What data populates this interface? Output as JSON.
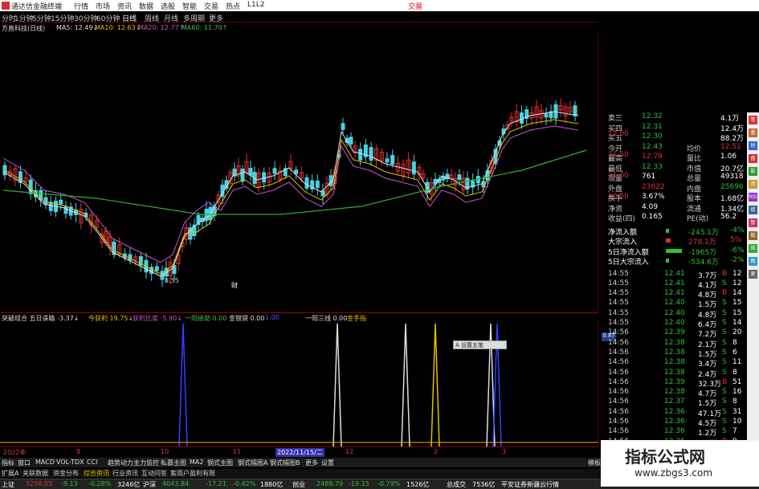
{
  "titlebar": {
    "app": "通达信金融终端",
    "menu": [
      "行情",
      "市场",
      "资讯",
      "数据",
      "选股",
      "智能",
      "交易",
      "热点",
      "L1L2"
    ],
    "right": "交易"
  },
  "periodbar": [
    "分时",
    "1分钟",
    "5分钟",
    "15分钟",
    "30分钟",
    "60分钟",
    "日线",
    "周线",
    "月线",
    "多周期",
    "更多"
  ],
  "malegend": {
    "name": "方直科技(日线)",
    "ma5": "MA5: 12.49↓",
    "ma10": "MA10: 12.63↓",
    "ma20": "MA20: 12.77↑",
    "ma60": "MA60: 11.70↑"
  },
  "kchart": {
    "low_label": "8.55",
    "marker": "财"
  },
  "ilegend": [
    {
      "t": "突破组合 五日诛瞌 -3.37↓",
      "c": "#ddd"
    },
    {
      "t": "今获利 19.75↓",
      "c": "#e0c000"
    },
    {
      "t": "获利比度 -5.90↓",
      "c": "#d050d0"
    },
    {
      "t": "一阳接助 0.00",
      "c": "#40c040"
    },
    {
      "t": "金银袋 0.00",
      "c": "#ddd"
    },
    {
      "t": "1.00",
      "c": "#4060ff"
    },
    {
      "t": "一阳三线 0.00",
      "c": "#ddd"
    },
    {
      "t": "金手指",
      "c": "#e0c000"
    }
  ],
  "datebar": [
    "2022年",
    "8",
    "10",
    "11",
    "2022/11/15/二",
    "12",
    "2",
    "3"
  ],
  "tabs": [
    "指标",
    "窗口",
    "MACD",
    "VOL-TDX",
    "CCI",
    "趋势动力",
    "主力监控",
    "私募主图",
    "MA2",
    "钢式主图",
    "钢式幅图A",
    "钢式幅图B",
    "更多",
    "设置"
  ],
  "stockbar": [
    {
      "t": "扩展A",
      "c": "#ccc"
    },
    {
      "t": "关联数据",
      "c": "#ccc"
    },
    {
      "t": "资金分布",
      "c": "#ccc"
    },
    {
      "t": "综合资讯",
      "c": "#e0c000"
    },
    {
      "t": "行业资讯",
      "c": "#ccc"
    },
    {
      "t": "互动问答",
      "c": "#ccc"
    },
    {
      "t": "紫雨户盈利有限",
      "c": "#ccc"
    }
  ],
  "statusbar": [
    {
      "t": "上证",
      "c": "#fff"
    },
    {
      "t": "3258.03",
      "c": "#e03030"
    },
    {
      "t": "-9.13",
      "c": "#30c030"
    },
    {
      "t": "-0.28%",
      "c": "#30c030"
    },
    {
      "t": "3246亿",
      "c": "#fff"
    },
    {
      "t": "沪深",
      "c": "#fff"
    },
    {
      "t": "4043.84",
      "c": "#30c030"
    },
    {
      "t": "-17.21",
      "c": "#30c030"
    },
    {
      "t": "-0.42%",
      "c": "#30c030"
    },
    {
      "t": "1880亿",
      "c": "#fff"
    },
    {
      "t": "创业",
      "c": "#fff"
    },
    {
      "t": "2489.79",
      "c": "#30c030"
    },
    {
      "t": "-19.15",
      "c": "#30c030"
    },
    {
      "t": "-0.79%",
      "c": "#30c030"
    },
    {
      "t": "1526亿",
      "c": "#fff"
    },
    {
      "t": "总成交",
      "c": "#fff"
    },
    {
      "t": "7536亿",
      "c": "#fff"
    },
    {
      "t": "平安证券新疆云行情",
      "c": "#fff"
    }
  ],
  "quote": [
    {
      "l": "卖三",
      "v": "12.32",
      "v2": "4.1万"
    },
    {
      "l": "买四",
      "v": "12.31",
      "v2": "12.4万"
    },
    {
      "l": "买五",
      "v": "12.30",
      "v2": "88.2万"
    },
    {
      "l": "今开",
      "v": "12.43",
      "l2": "均价",
      "v2": "12.51"
    },
    {
      "l": "最高",
      "v": "12.79",
      "l2": "量比",
      "v2": "1.06"
    },
    {
      "l": "最低",
      "v": "12.33",
      "l2": "市值",
      "v2": "20.7亿"
    },
    {
      "l": "现量",
      "v": "761",
      "l2": "总量",
      "v2": "49318"
    },
    {
      "l": "外盘",
      "v": "23622",
      "l2": "内盘",
      "v2": "25696"
    },
    {
      "l": "换手",
      "v": "3.67%",
      "l2": "股本",
      "v2": "1.68亿"
    },
    {
      "l": "净资",
      "v": "4.09",
      "l2": "流通",
      "v2": "1.34亿"
    },
    {
      "l": "收益(四)",
      "v": "0.165",
      "l2": "PE(动)",
      "v2": "56.2"
    }
  ],
  "flows": [
    {
      "l": "净流入额",
      "v": "-245.1万",
      "p": "-4%"
    },
    {
      "l": "大宗流入",
      "v": "278.1万",
      "p": "5%"
    },
    {
      "l": "5日净流入额",
      "v": "-1965万",
      "p": "-6%"
    },
    {
      "l": "5日大宗流入",
      "v": "-534.6万",
      "p": "-2%"
    }
  ],
  "trades": [
    [
      "14:55",
      "12.41",
      "3.7万",
      "B",
      "12"
    ],
    [
      "14:55",
      "12.41",
      "4.1万",
      "S",
      "12"
    ],
    [
      "14:55",
      "12.41",
      "4.8万",
      "B",
      "14"
    ],
    [
      "14:55",
      "12.40",
      "1.5万",
      "S",
      "15"
    ],
    [
      "14:55",
      "12.40",
      "4.8万",
      "S",
      "15"
    ],
    [
      "14:55",
      "12.40",
      "6.4万",
      "S",
      "14"
    ],
    [
      "14:56",
      "12.39",
      "7.2万",
      "S",
      "20"
    ],
    [
      "14:56",
      "12.38",
      "2.1万",
      "S",
      "8"
    ],
    [
      "14:56",
      "12.38",
      "1.5万",
      "S",
      "6"
    ],
    [
      "14:56",
      "12.38",
      "3.4万",
      "S",
      "11"
    ],
    [
      "14:56",
      "12.38",
      "2.4万",
      "S",
      "8"
    ],
    [
      "14:56",
      "12.39",
      "32.3万",
      "B",
      "51"
    ],
    [
      "14:56",
      "12.38",
      "4.7万",
      "S",
      "16"
    ],
    [
      "14:56",
      "12.37",
      "1.5万",
      "S",
      "8"
    ],
    [
      "14:56",
      "12.36",
      "47.1万",
      "S",
      "31"
    ],
    [
      "14:56",
      "12.36",
      "4.5万",
      "S",
      "10"
    ],
    [
      "14:56",
      "12.36",
      "1.2万",
      "S",
      "7"
    ],
    [
      "14:56",
      "12.36",
      "6.7万",
      "B",
      "9"
    ]
  ],
  "sidebar": [
    "笔",
    "基",
    "财",
    "盘",
    "股",
    "资",
    "RSI",
    "组",
    "智",
    "板",
    "指",
    "图",
    "更"
  ],
  "rprice": [
    "12.00",
    "11.50",
    "11.00",
    "10.50"
  ],
  "rtick": "0.87",
  "floatbox": "A 设置五笔",
  "watermark": {
    "t1": "指标公式网",
    "t2": "www.zbgs3.com"
  },
  "footer_right": "图交F10",
  "tab_right": "模板"
}
